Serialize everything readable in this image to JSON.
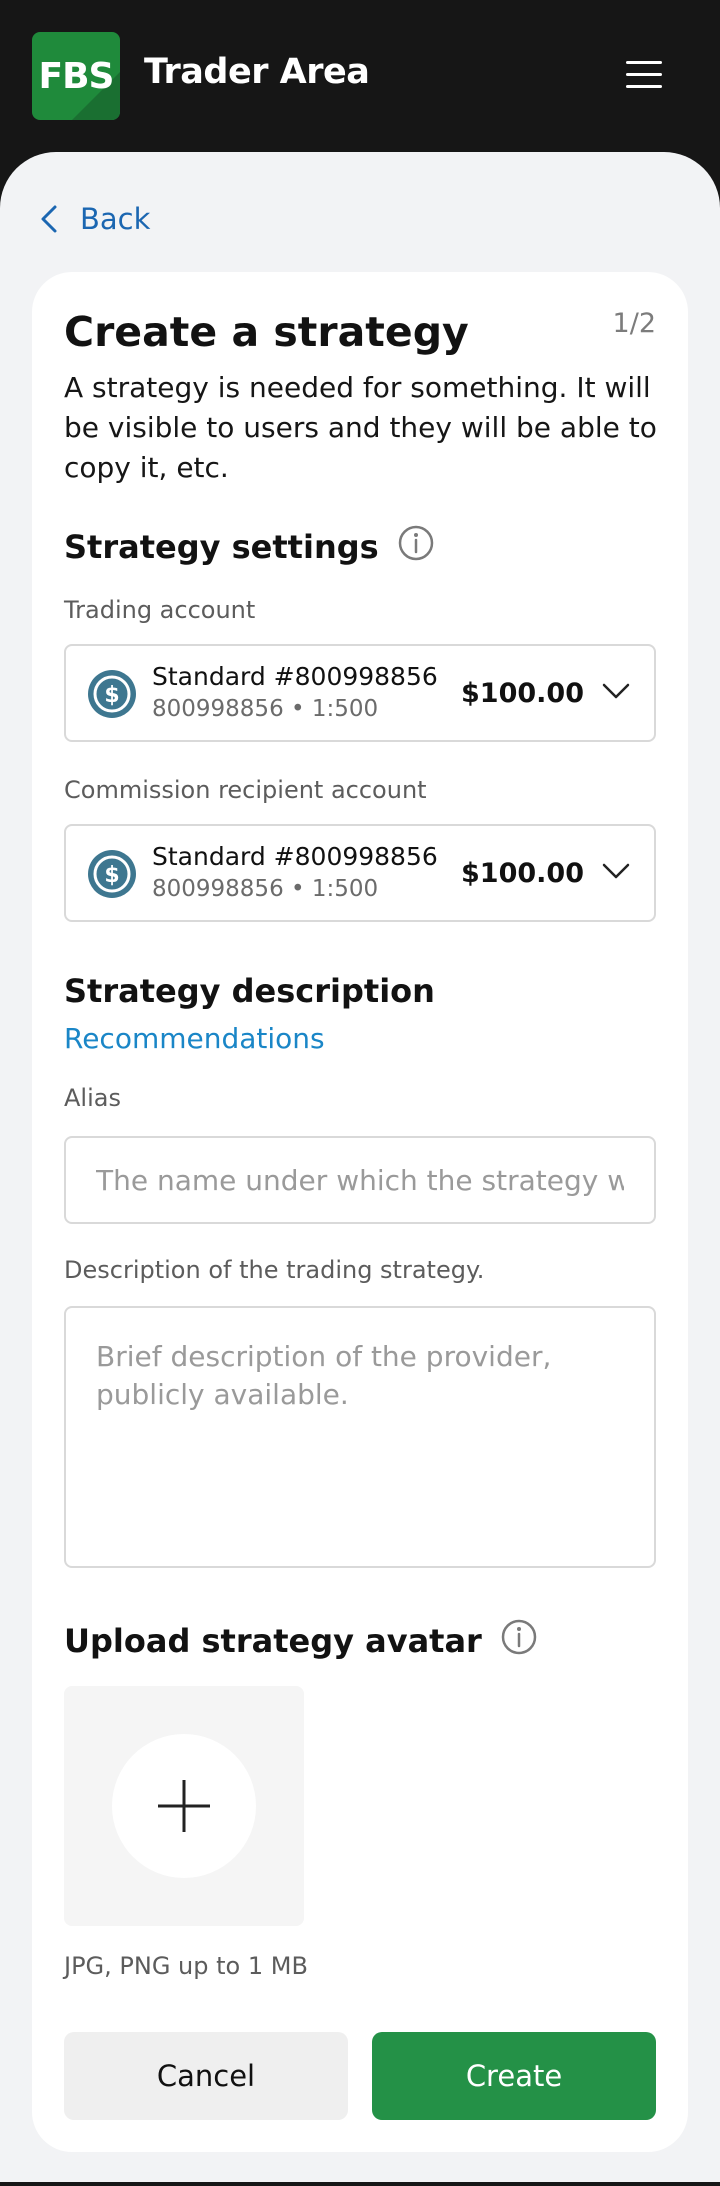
{
  "header": {
    "logo_text": "FBS",
    "app_title": "Trader Area",
    "menu_icon": "hamburger-menu-icon",
    "brand_color": "#1f8a3b"
  },
  "nav": {
    "back_label": "Back",
    "back_icon": "chevron-left-icon"
  },
  "form": {
    "step": "1/2",
    "title": "Create a strategy",
    "intro": "A strategy is needed for something. It will be visible to users and they will be able to copy it, etc.",
    "settings": {
      "heading": "Strategy settings",
      "trading_account": {
        "label": "Trading account",
        "name": "Standard #800998856",
        "sub": "800998856 • 1:500",
        "amount": "$100.00"
      },
      "commission_account": {
        "label": "Commission recipient account",
        "name": "Standard #800998856",
        "sub": "800998856 • 1:500",
        "amount": "$100.00"
      }
    },
    "description": {
      "heading": "Strategy description",
      "recommendations_link": "Recommendations",
      "alias_label": "Alias",
      "alias_placeholder": "The name under which the strategy wi...",
      "desc_label": "Description of the trading strategy.",
      "desc_placeholder": "Brief description of the provider, publicly available."
    },
    "avatar": {
      "heading": "Upload strategy avatar",
      "hint": "JPG, PNG up to 1 MB"
    },
    "actions": {
      "cancel": "Cancel",
      "create": "Create",
      "create_color": "#249147"
    }
  }
}
